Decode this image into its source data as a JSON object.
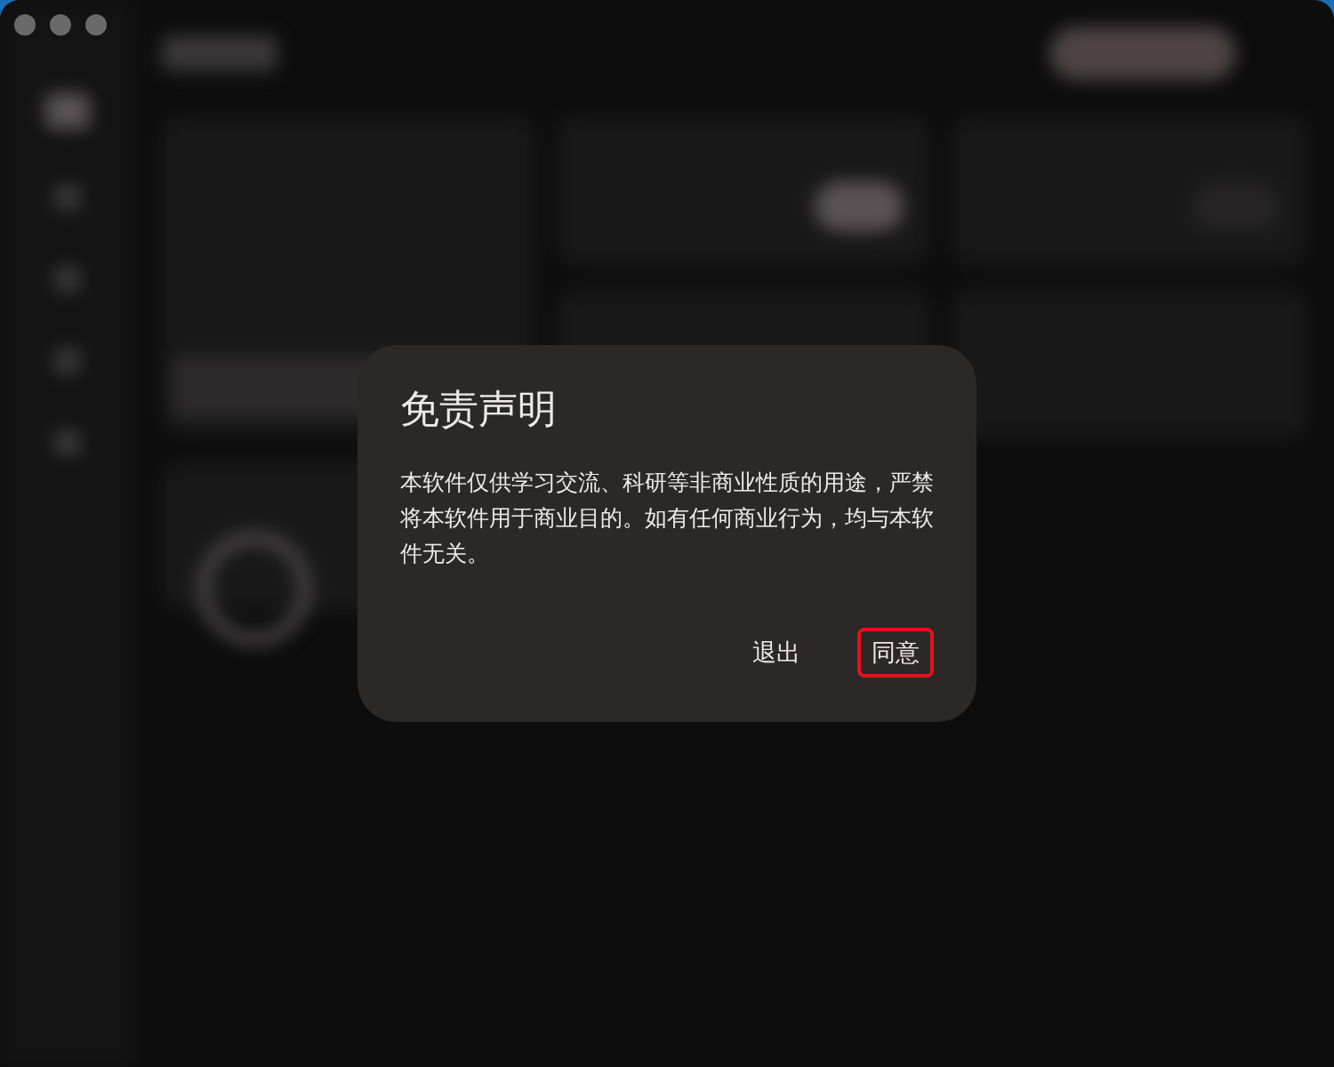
{
  "dialog": {
    "title": "免责声明",
    "message": "本软件仅供学习交流、科研等非商业性质的用途，严禁将本软件用于商业目的。如有任何商业行为，均与本软件无关。",
    "buttons": [
      {
        "label": "退出",
        "focused": false
      },
      {
        "label": "同意",
        "focused": true
      }
    ]
  }
}
